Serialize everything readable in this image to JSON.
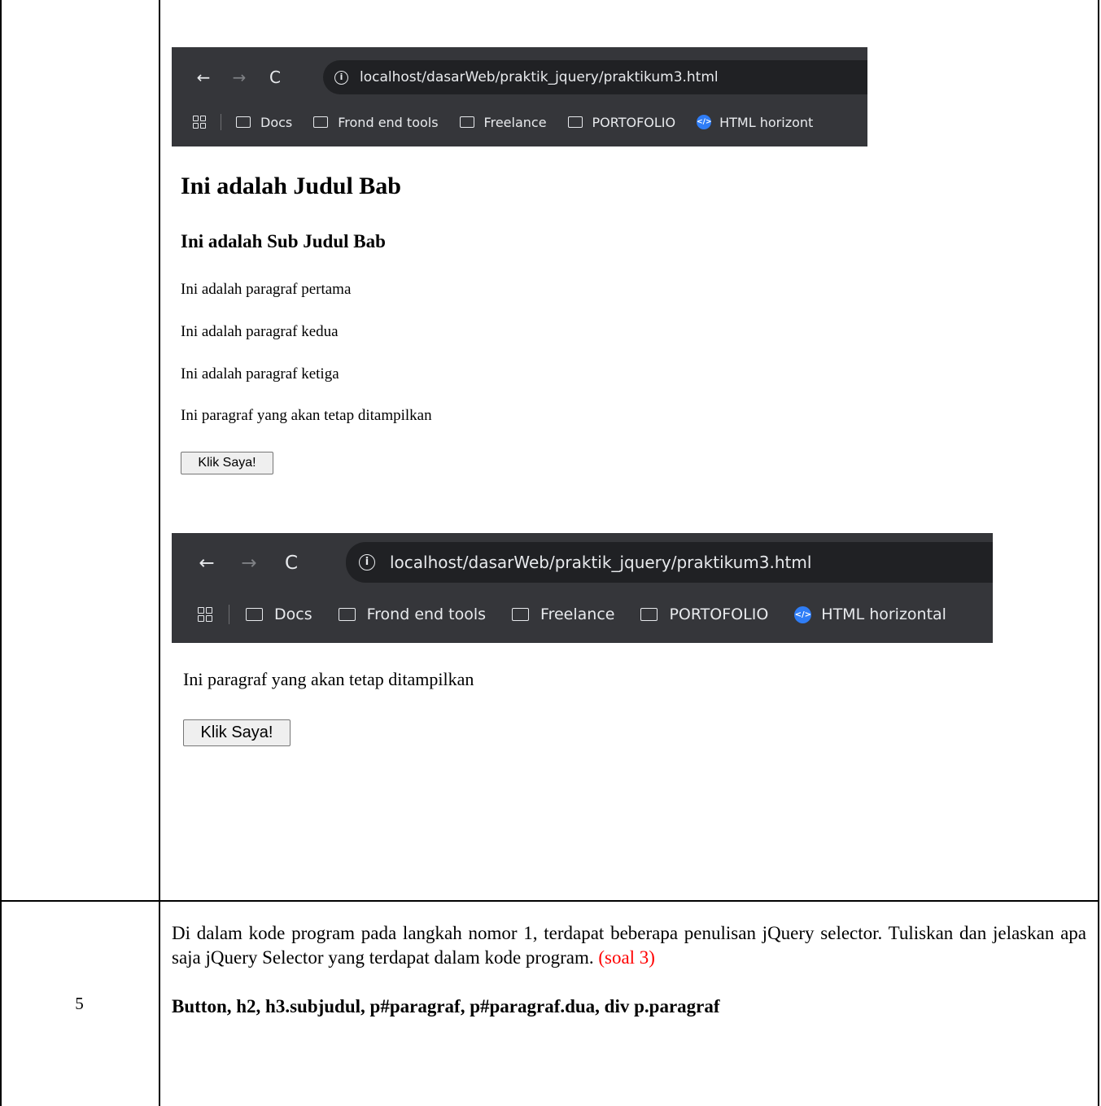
{
  "browser_1": {
    "url": "localhost/dasarWeb/praktik_jquery/praktikum3.html",
    "bookmarks": [
      "Docs",
      "Frond end tools",
      "Freelance",
      "PORTOFOLIO"
    ],
    "truncated_bookmark": "HTML horizont"
  },
  "page_before": {
    "heading": "Ini adalah Judul Bab",
    "subheading": "Ini adalah Sub Judul Bab",
    "paragraphs": [
      "Ini adalah paragraf pertama",
      "Ini adalah paragraf kedua",
      "Ini adalah paragraf ketiga",
      "Ini paragraf yang akan tetap ditampilkan"
    ],
    "button_label": "Klik Saya!"
  },
  "browser_2": {
    "url": "localhost/dasarWeb/praktik_jquery/praktikum3.html",
    "bookmarks": [
      "Docs",
      "Frond end tools",
      "Freelance",
      "PORTOFOLIO"
    ],
    "truncated_bookmark": "HTML horizontal"
  },
  "page_after": {
    "paragraph": "Ini paragraf yang akan tetap ditampilkan",
    "button_label": "Klik Saya!"
  },
  "row_2": {
    "number": "5",
    "question": "Di dalam kode program pada langkah nomor 1, terdapat beberapa penulisan jQuery selector. Tuliskan dan jelaskan apa saja jQuery Selector yang terdapat dalam kode program.",
    "question_tag": "(soal 3)",
    "answer": "Button, h2, h3.subjudul, p#paragraf, p#paragraf.dua, div p.paragraf"
  },
  "colors": {
    "browser_bg": "#35363a",
    "omnibox_bg": "#202124",
    "question_tag": "#ff0000"
  },
  "icons": [
    "back-arrow-icon",
    "forward-arrow-icon",
    "reload-icon",
    "info-icon",
    "apps-grid-icon",
    "folder-icon",
    "html-code-icon"
  ]
}
